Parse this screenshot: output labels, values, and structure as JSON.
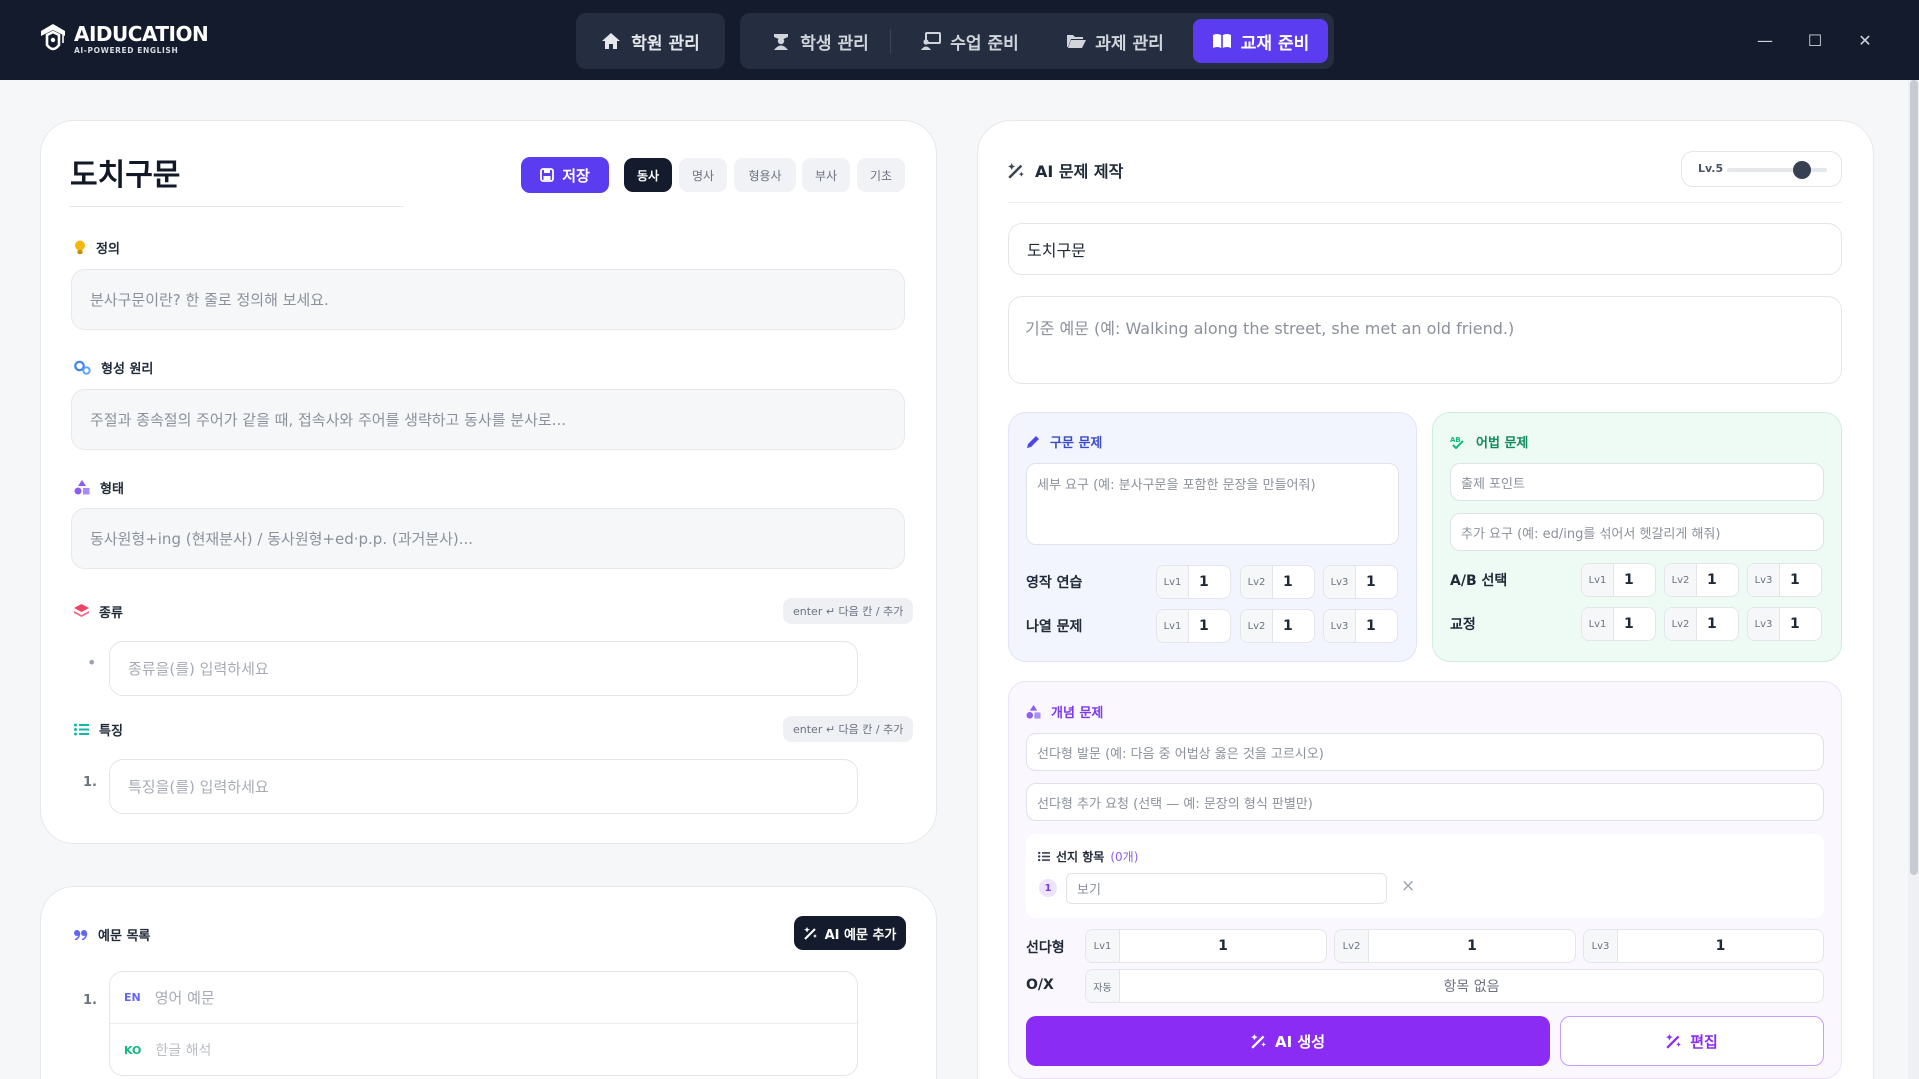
{
  "app": {
    "brand": "AIDUCATION",
    "tagline": "AI-POWERED ENGLISH"
  },
  "nav": {
    "academy": "학원 관리",
    "students": "학생 관리",
    "class_prep": "수업 준비",
    "assignments": "과제 관리",
    "materials": "교재 준비"
  },
  "window": {
    "minimize": "—",
    "maximize": "☐",
    "close": "✕"
  },
  "concept": {
    "title": "도치구문",
    "save_label": "저장",
    "pos_tags": [
      "동사",
      "명사",
      "형용사",
      "부사",
      "기초"
    ],
    "definition_label": "정의",
    "definition_placeholder": "분사구문이란? 한 줄로 정의해 보세요.",
    "principle_label": "형성 원리",
    "principle_placeholder": "주절과 종속절의 주어가 같을 때, 접속사와 주어를 생략하고 동사를 분사로...",
    "form_label": "형태",
    "form_placeholder": "동사원형+ing (현재분사) / 동사원형+ed·p.p. (과거분사)...",
    "types_label": "종류",
    "types_hint": "enter ↵ 다음 칸 / 추가",
    "types_bullet": "•",
    "types_placeholder": "종류을(를) 입력하세요",
    "features_label": "특징",
    "features_hint": "enter ↵ 다음 칸 / 추가",
    "features_index": "1.",
    "features_placeholder": "특징을(를) 입력하세요"
  },
  "examples": {
    "label": "예문 목록",
    "ai_add_label": "AI 예문 추가",
    "index": "1.",
    "en_tag": "EN",
    "en_placeholder": "영어 예문",
    "ko_tag": "KO",
    "ko_placeholder": "한글 해석"
  },
  "ai_panel": {
    "title": "AI 문제 제작",
    "level_label": "Lv.5",
    "level_value": 0.75,
    "topic_value": "도치구문",
    "base_sentence_placeholder": "기준 예문 (예: Walking along the street, she met an old friend.)",
    "syntax": {
      "title": "구문 문제",
      "detail_placeholder": "세부 요구 (예: 분사구문을 포함한 문장을 만들어줘)",
      "rows": [
        {
          "label": "영작 연습",
          "levels": [
            {
              "tag": "Lv1",
              "value": "1"
            },
            {
              "tag": "Lv2",
              "value": "1"
            },
            {
              "tag": "Lv3",
              "value": "1"
            }
          ]
        },
        {
          "label": "나열 문제",
          "levels": [
            {
              "tag": "Lv1",
              "value": "1"
            },
            {
              "tag": "Lv2",
              "value": "1"
            },
            {
              "tag": "Lv3",
              "value": "1"
            }
          ]
        }
      ]
    },
    "grammar": {
      "title": "어법 문제",
      "point_placeholder": "출제 포인트",
      "extra_placeholder": "추가 요구 (예: ed/ing를 섞어서 헷갈리게 해줘)",
      "rows": [
        {
          "label": "A/B 선택",
          "levels": [
            {
              "tag": "Lv1",
              "value": "1"
            },
            {
              "tag": "Lv2",
              "value": "1"
            },
            {
              "tag": "Lv3",
              "value": "1"
            }
          ]
        },
        {
          "label": "교정",
          "levels": [
            {
              "tag": "Lv1",
              "value": "1"
            },
            {
              "tag": "Lv2",
              "value": "1"
            },
            {
              "tag": "Lv3",
              "value": "1"
            }
          ]
        }
      ]
    },
    "concept_q": {
      "title": "개념 문제",
      "stem_placeholder": "선다형 발문 (예: 다음 중 어법상 옳은 것을 고르시오)",
      "extra_placeholder": "선다형 추가 요청 (선택 — 예: 문장의 형식 판별만)",
      "choices_label": "선지 항목",
      "choices_count": "(0개)",
      "choice_index": "1",
      "choice_placeholder": "보기",
      "remove": "×",
      "mc_label": "선다형",
      "mc_levels": [
        {
          "tag": "Lv1",
          "value": "1"
        },
        {
          "tag": "Lv2",
          "value": "1"
        },
        {
          "tag": "Lv3",
          "value": "1"
        }
      ],
      "ox_label": "O/X",
      "ox_tag": "자동",
      "ox_value": "항목 없음"
    },
    "generate_label": "AI 생성",
    "edit_label": "편집"
  },
  "colors": {
    "topbar": "#141b2d",
    "accent": "#5b3cf0",
    "generate": "#8b2cf5"
  }
}
